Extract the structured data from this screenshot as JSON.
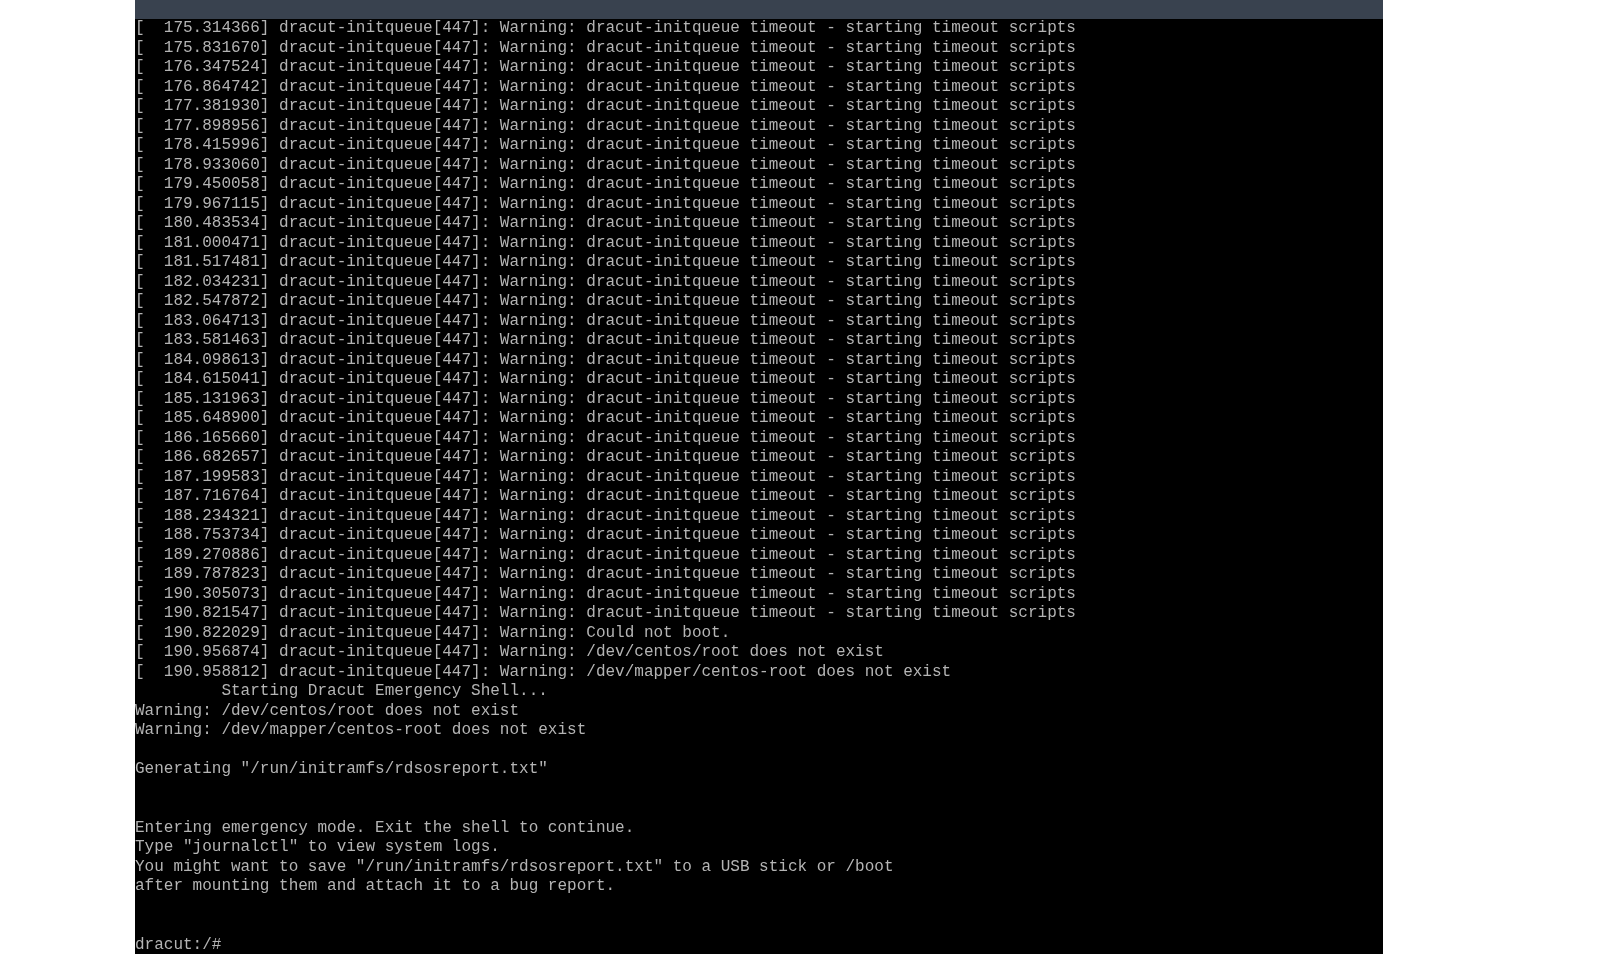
{
  "console": {
    "sections": [
      {
        "kind": "log",
        "lines": [
          "[  175.314366] dracut-initqueue[447]: Warning: dracut-initqueue timeout - starting timeout scripts",
          "[  175.831670] dracut-initqueue[447]: Warning: dracut-initqueue timeout - starting timeout scripts",
          "[  176.347524] dracut-initqueue[447]: Warning: dracut-initqueue timeout - starting timeout scripts",
          "[  176.864742] dracut-initqueue[447]: Warning: dracut-initqueue timeout - starting timeout scripts",
          "[  177.381930] dracut-initqueue[447]: Warning: dracut-initqueue timeout - starting timeout scripts",
          "[  177.898956] dracut-initqueue[447]: Warning: dracut-initqueue timeout - starting timeout scripts",
          "[  178.415996] dracut-initqueue[447]: Warning: dracut-initqueue timeout - starting timeout scripts",
          "[  178.933060] dracut-initqueue[447]: Warning: dracut-initqueue timeout - starting timeout scripts",
          "[  179.450058] dracut-initqueue[447]: Warning: dracut-initqueue timeout - starting timeout scripts",
          "[  179.967115] dracut-initqueue[447]: Warning: dracut-initqueue timeout - starting timeout scripts",
          "[  180.483534] dracut-initqueue[447]: Warning: dracut-initqueue timeout - starting timeout scripts",
          "[  181.000471] dracut-initqueue[447]: Warning: dracut-initqueue timeout - starting timeout scripts",
          "[  181.517481] dracut-initqueue[447]: Warning: dracut-initqueue timeout - starting timeout scripts",
          "[  182.034231] dracut-initqueue[447]: Warning: dracut-initqueue timeout - starting timeout scripts",
          "[  182.547872] dracut-initqueue[447]: Warning: dracut-initqueue timeout - starting timeout scripts",
          "[  183.064713] dracut-initqueue[447]: Warning: dracut-initqueue timeout - starting timeout scripts",
          "[  183.581463] dracut-initqueue[447]: Warning: dracut-initqueue timeout - starting timeout scripts",
          "[  184.098613] dracut-initqueue[447]: Warning: dracut-initqueue timeout - starting timeout scripts",
          "[  184.615041] dracut-initqueue[447]: Warning: dracut-initqueue timeout - starting timeout scripts",
          "[  185.131963] dracut-initqueue[447]: Warning: dracut-initqueue timeout - starting timeout scripts",
          "[  185.648900] dracut-initqueue[447]: Warning: dracut-initqueue timeout - starting timeout scripts",
          "[  186.165660] dracut-initqueue[447]: Warning: dracut-initqueue timeout - starting timeout scripts",
          "[  186.682657] dracut-initqueue[447]: Warning: dracut-initqueue timeout - starting timeout scripts",
          "[  187.199583] dracut-initqueue[447]: Warning: dracut-initqueue timeout - starting timeout scripts",
          "[  187.716764] dracut-initqueue[447]: Warning: dracut-initqueue timeout - starting timeout scripts",
          "[  188.234321] dracut-initqueue[447]: Warning: dracut-initqueue timeout - starting timeout scripts",
          "[  188.753734] dracut-initqueue[447]: Warning: dracut-initqueue timeout - starting timeout scripts",
          "[  189.270886] dracut-initqueue[447]: Warning: dracut-initqueue timeout - starting timeout scripts",
          "[  189.787823] dracut-initqueue[447]: Warning: dracut-initqueue timeout - starting timeout scripts",
          "[  190.305073] dracut-initqueue[447]: Warning: dracut-initqueue timeout - starting timeout scripts",
          "[  190.821547] dracut-initqueue[447]: Warning: dracut-initqueue timeout - starting timeout scripts",
          "[  190.822029] dracut-initqueue[447]: Warning: Could not boot.",
          "[  190.956874] dracut-initqueue[447]: Warning: /dev/centos/root does not exist",
          "[  190.958812] dracut-initqueue[447]: Warning: /dev/mapper/centos-root does not exist",
          "         Starting Dracut Emergency Shell...",
          "Warning: /dev/centos/root does not exist",
          "Warning: /dev/mapper/centos-root does not exist"
        ]
      },
      {
        "kind": "report",
        "lines": [
          "Generating \"/run/initramfs/rdsosreport.txt\""
        ]
      },
      {
        "kind": "notice",
        "lines": [
          "Entering emergency mode. Exit the shell to continue.",
          "Type \"journalctl\" to view system logs.",
          "You might want to save \"/run/initramfs/rdsosreport.txt\" to a USB stick or /boot",
          "after mounting them and attach it to a bug report."
        ]
      },
      {
        "kind": "prompt",
        "lines": [
          "dracut:/#"
        ]
      }
    ]
  }
}
